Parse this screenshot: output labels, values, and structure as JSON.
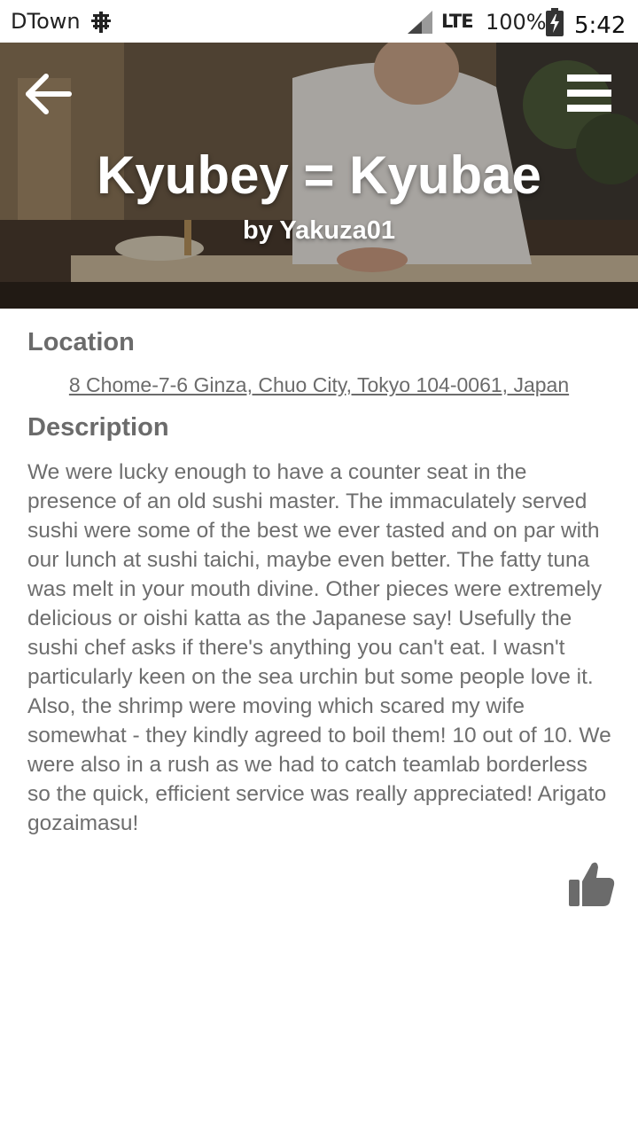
{
  "status_bar": {
    "carrier": "DTown",
    "network": "LTE",
    "battery": "100%",
    "time": "5:42"
  },
  "header": {
    "title": "Kyubey = Kyubae",
    "author": "by Yakuza01"
  },
  "location": {
    "heading": "Location",
    "address": "8 Chome-7-6 Ginza, Chuo City, Tokyo 104-0061, Japan"
  },
  "description": {
    "heading": "Description",
    "text": "We were lucky enough to have a counter seat in the presence of an old sushi master. The immaculately served sushi were some of the best we ever tasted and on par with our lunch at sushi taichi, maybe even better. The fatty tuna was melt in your mouth divine. Other pieces were extremely delicious or oishi katta as the Japanese say! Usefully the sushi chef asks if there's anything you can't eat. I wasn't particularly keen on the sea urchin but some people love it. Also, the shrimp were moving which scared my wife somewhat - they kindly agreed to boil them! 10 out of 10. We were also in a rush as we had to catch teamlab borderless so the quick, efficient service was really appreciated! Arigato gozaimasu!"
  },
  "icons": {
    "back": "arrow-left-icon",
    "menu": "hamburger-menu-icon",
    "like": "thumbs-up-icon"
  },
  "colors": {
    "heading": "#6b6b6b",
    "body_text": "#6e6e6e",
    "title_text": "#ffffff"
  }
}
